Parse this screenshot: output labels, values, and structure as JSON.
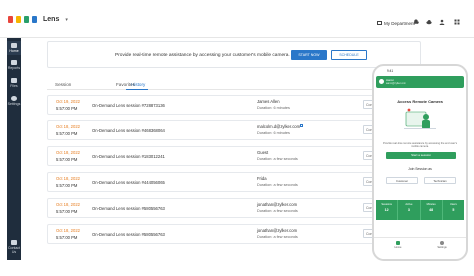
{
  "app": {
    "name": "Lens",
    "logo_colors": [
      "#e8453c",
      "#f7b500",
      "#2aa06a",
      "#2a77c9"
    ],
    "department": "My Department"
  },
  "sidebar": {
    "items": [
      {
        "label": "Home",
        "icon": "home-icon"
      },
      {
        "label": "Reports",
        "icon": "reports-icon"
      },
      {
        "label": "Files",
        "icon": "files-icon"
      },
      {
        "label": "Settings",
        "icon": "gear-icon"
      },
      {
        "label": "Contact Us",
        "icon": "contact-icon"
      }
    ]
  },
  "banner": {
    "text": "Provide real-time remote assistance by accessing your customer's mobile camera.",
    "start_label": "START NOW",
    "schedule_label": "SCHEDULE"
  },
  "tabs": [
    {
      "label": "Session"
    },
    {
      "label": "History"
    },
    {
      "label": "Favorites"
    }
  ],
  "rows": [
    {
      "date": "Oct 19, 2022",
      "time": "5:57:00 PM",
      "session": "On-Demand Lens session #728873136",
      "name": "James Allen",
      "duration": "Duration: 6 minutes",
      "action": "Conn"
    },
    {
      "date": "Oct 18, 2022",
      "time": "5:57:00 PM",
      "session": "On-Demand Lens session #468368064",
      "name": "malcolm.d@zylker.com",
      "duration": "Duration: 6 minutes",
      "action": "Conn"
    },
    {
      "date": "Oct 18, 2022",
      "time": "5:57:00 PM",
      "session": "On-Demand Lens session #183012241",
      "name": "Guest",
      "duration": "Duration: a few seconds",
      "action": "Conn"
    },
    {
      "date": "Oct 18, 2022",
      "time": "5:57:00 PM",
      "session": "On-Demand Lens session #444056065",
      "name": "Frida",
      "duration": "Duration: a few seconds",
      "action": "Conn"
    },
    {
      "date": "Oct 18, 2022",
      "time": "5:57:00 PM",
      "session": "On-Demand Lens session #580556763",
      "name": "jonathan@zylker.com",
      "duration": "Duration: a few seconds",
      "action": "Conn"
    },
    {
      "date": "Oct 18, 2022",
      "time": "5:57:00 PM",
      "session": "On-Demand Lens session #580556763",
      "name": "jonathan@zylker.com",
      "duration": "Duration: a few seconds",
      "action": "Conn"
    }
  ],
  "phone": {
    "status_time": "9:41",
    "user_name": "Aaron",
    "user_email": "aaron@zylker.com",
    "title": "Access Remote Camera",
    "description": "Provide real-time remote assistance by accessing the end user's mobile camera.",
    "start_label": "Start a session",
    "join_label": "Join Session as",
    "options": [
      "Customer",
      "Technician"
    ],
    "stats": [
      {
        "label": "Sessions",
        "value": "12"
      },
      {
        "label": "Active",
        "value": "3"
      },
      {
        "label": "Minutes",
        "value": "48"
      },
      {
        "label": "Users",
        "value": "5"
      }
    ],
    "nav": [
      {
        "label": "Home"
      },
      {
        "label": "Settings"
      }
    ],
    "accent": "#2f9e5d"
  },
  "colors": {
    "primary": "#2a77c9",
    "date": "#e67e22",
    "sidebar": "#1f2d3d"
  }
}
